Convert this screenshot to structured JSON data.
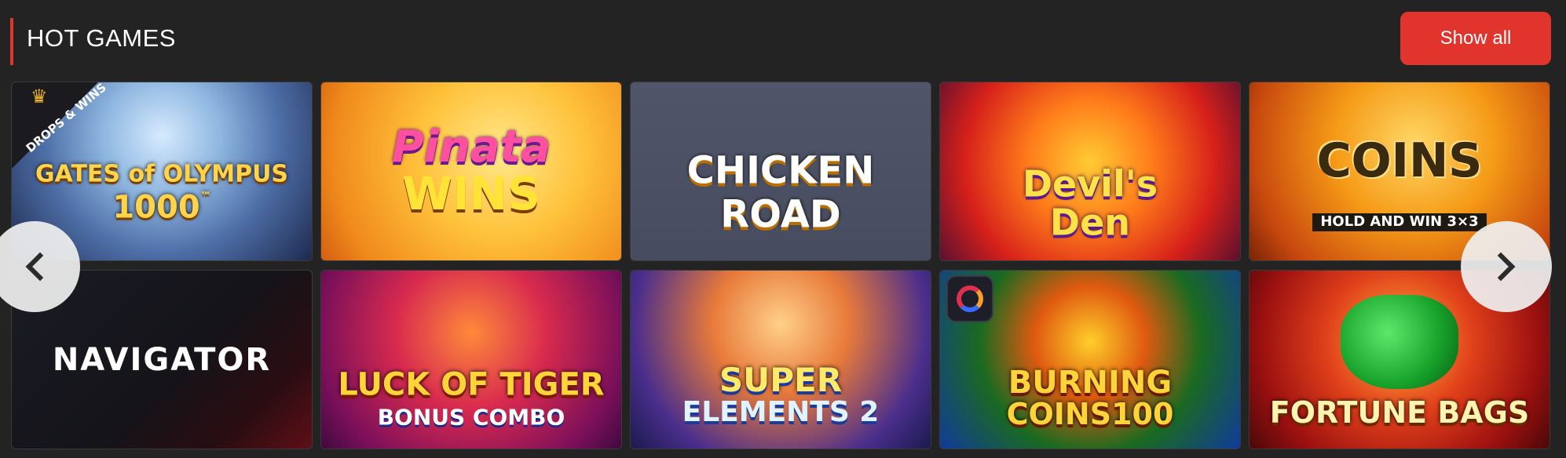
{
  "section": {
    "title": "HOT GAMES",
    "show_all_label": "Show all"
  },
  "games": [
    {
      "title": "GATES of OLYMPUS",
      "subtitle": "1000",
      "badge": "DROPS & WINS",
      "trademark": "™"
    },
    {
      "title": "Pinata",
      "subtitle": "WINS"
    },
    {
      "title": "CHICKEN",
      "subtitle": "ROAD"
    },
    {
      "title": "Devil's",
      "subtitle": "Den"
    },
    {
      "title": "COINS",
      "subtitle": "HOLD AND WIN 3×3"
    },
    {
      "title": "NAVIGATOR"
    },
    {
      "title": "LUCK OF TIGER",
      "subtitle": "BONUS COMBO"
    },
    {
      "title": "SUPER",
      "subtitle": "ELEMENTS 2"
    },
    {
      "title": "BURNING",
      "subtitle": "COINS100"
    },
    {
      "title": "FORTUNE BAGS"
    }
  ],
  "icons": {
    "prev": "chevron-left-icon",
    "next": "chevron-right-icon",
    "crown": "crown-icon"
  },
  "colors": {
    "accent": "#e0342d",
    "background": "#232323",
    "arrow_bg": "#f0f0f0"
  }
}
